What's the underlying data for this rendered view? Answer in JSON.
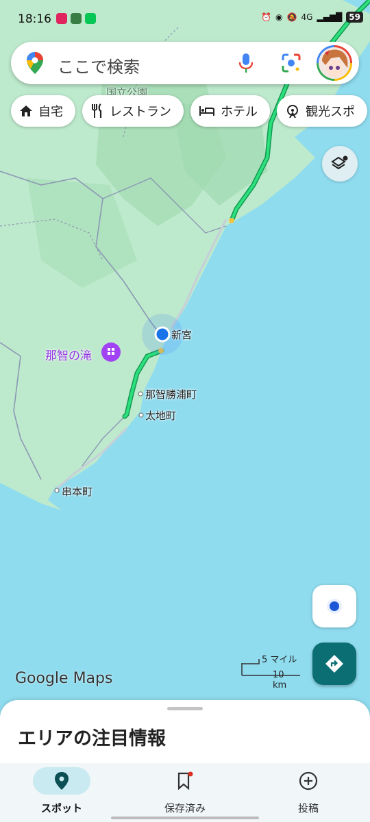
{
  "status": {
    "time": "18:16",
    "network": "4G",
    "battery": "59"
  },
  "search": {
    "placeholder": "ここで検索"
  },
  "chips": [
    {
      "label": "自宅",
      "icon": "home-icon"
    },
    {
      "label": "レストラン",
      "icon": "restaurant-icon"
    },
    {
      "label": "ホテル",
      "icon": "hotel-icon"
    },
    {
      "label": "観光スポ",
      "icon": "attraction-icon"
    }
  ],
  "map": {
    "park_label": "国立公園",
    "places": {
      "shingu": "新宮",
      "nachi_falls": "那智の滝",
      "nachikatsuura": "那智勝浦町",
      "taiji": "太地町",
      "kushimoto": "串本町"
    },
    "scale": {
      "miles": "5 マイル",
      "km": "10 km"
    },
    "logo": "Google Maps"
  },
  "sheet": {
    "title": "エリアの注目情報"
  },
  "nav": [
    {
      "label": "スポット",
      "icon": "location-pin-icon",
      "active": true
    },
    {
      "label": "保存済み",
      "icon": "bookmark-icon",
      "active": false
    },
    {
      "label": "投稿",
      "icon": "add-circle-icon",
      "active": false
    }
  ],
  "colors": {
    "water": "#8fdcef",
    "land": "#bde9cc",
    "route": "#1ec26a",
    "accent": "#0b6e72",
    "location": "#1a73e8"
  }
}
